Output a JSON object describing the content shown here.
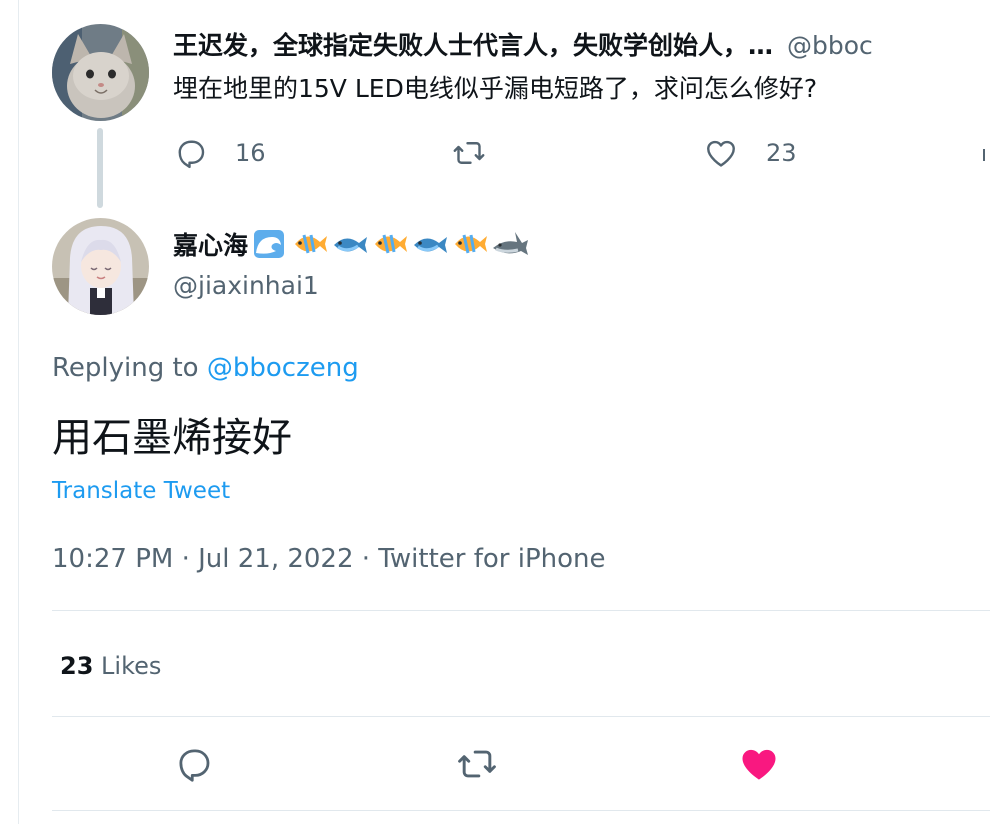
{
  "parent_tweet": {
    "author_name": "王迟发，全球指定失败人士代言人，失败学创始人，…",
    "handle": "@bboc",
    "text": "埋在地里的15V LED电线似乎漏电短路了，求问怎么修好?",
    "reply_count": "16",
    "like_count": "23"
  },
  "reply_tweet": {
    "author_name": "嘉心海",
    "name_emojis": [
      "water-wave-icon",
      "tropical-fish-icon",
      "fish-icon",
      "tropical-fish-icon",
      "fish-icon",
      "tropical-fish-icon",
      "shark-icon"
    ],
    "handle": "@jiaxinhai1",
    "replying_prefix": "Replying to",
    "replying_to": "@bboczeng",
    "text": "用石墨烯接好",
    "translate_label": "Translate Tweet",
    "timestamp": "10:27 PM · Jul 21, 2022 · Twitter for iPhone",
    "likes_count": "23",
    "likes_label": "Likes"
  },
  "colors": {
    "accent": "#1d9bf0",
    "like_pink": "#f91880",
    "secondary_text": "#536471",
    "thread_line": "#cfd9de"
  }
}
